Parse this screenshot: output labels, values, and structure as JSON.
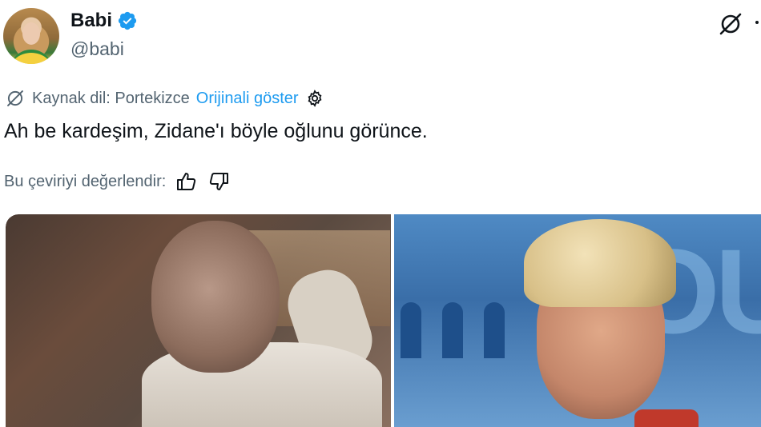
{
  "author": {
    "display_name": "Babi",
    "handle": "@babi",
    "verified": true
  },
  "icons": {
    "verified": "verified-badge-icon",
    "grok": "grok-icon",
    "translate": "translate-icon",
    "settings": "gear-icon",
    "thumbs_up": "thumbs-up-icon",
    "thumbs_down": "thumbs-down-icon"
  },
  "translation": {
    "source_label": "Kaynak dil: Portekizce",
    "show_original": "Orijinali göster"
  },
  "tweet": {
    "text": "Ah be kardeşim, Zidane'ı böyle oğlunu görünce."
  },
  "rating": {
    "label": "Bu çeviriyi değerlendir:"
  },
  "colors": {
    "accent": "#1d9bf0",
    "text": "#0f1419",
    "secondary": "#536471"
  }
}
